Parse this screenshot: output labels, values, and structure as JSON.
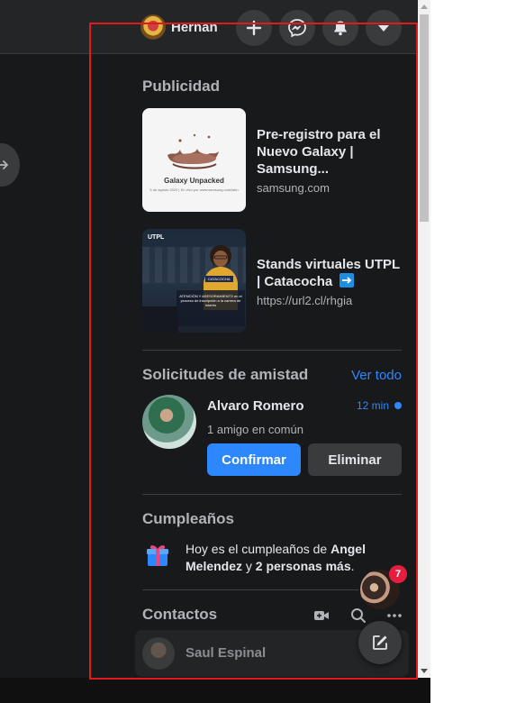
{
  "header": {
    "profile_name": "Hernan",
    "icons": [
      "plus-icon",
      "messenger-icon",
      "bell-icon",
      "caret-down-icon"
    ]
  },
  "ads": {
    "title": "Publicidad",
    "items": [
      {
        "title": "Pre-registro para el Nuevo Galaxy | Samsung...",
        "url": "samsung.com",
        "thumb_text": "Galaxy Unpacked",
        "thumb_subtext": "5 de agosto 2020 | En vivo por www.samsung.com/latin"
      },
      {
        "title": "Stands virtuales UTPL | Catacocha",
        "title_icon": "arrow-right-icon",
        "url": "https://url2.cl/rhgia",
        "thumb_logo": "UTPL",
        "thumb_tag": "CATACOCHA",
        "thumb_box": "ATENCIÓN Y ASESORAMIENTO en el proceso de inscripción a la carrera de interés"
      }
    ]
  },
  "friend_requests": {
    "title": "Solicitudes de amistad",
    "see_all": "Ver todo",
    "item": {
      "name": "Alvaro Romero",
      "time": "12 min",
      "mutual": "1 amigo en común",
      "confirm": "Confirmar",
      "delete": "Eliminar"
    }
  },
  "birthdays": {
    "title": "Cumpleaños",
    "prefix": "Hoy es el cumpleaños de ",
    "name": "Angel Melendez",
    "middle": " y ",
    "others": "2 personas más",
    "suffix": "."
  },
  "contacts": {
    "title": "Contactos",
    "items": [
      {
        "name": "Saul Espinal"
      }
    ]
  },
  "chat": {
    "badge_count": "7"
  },
  "colors": {
    "background": "#18191a",
    "accent": "#2d88ff",
    "badge": "#e41e3f",
    "highlight": "#e01a1a"
  }
}
